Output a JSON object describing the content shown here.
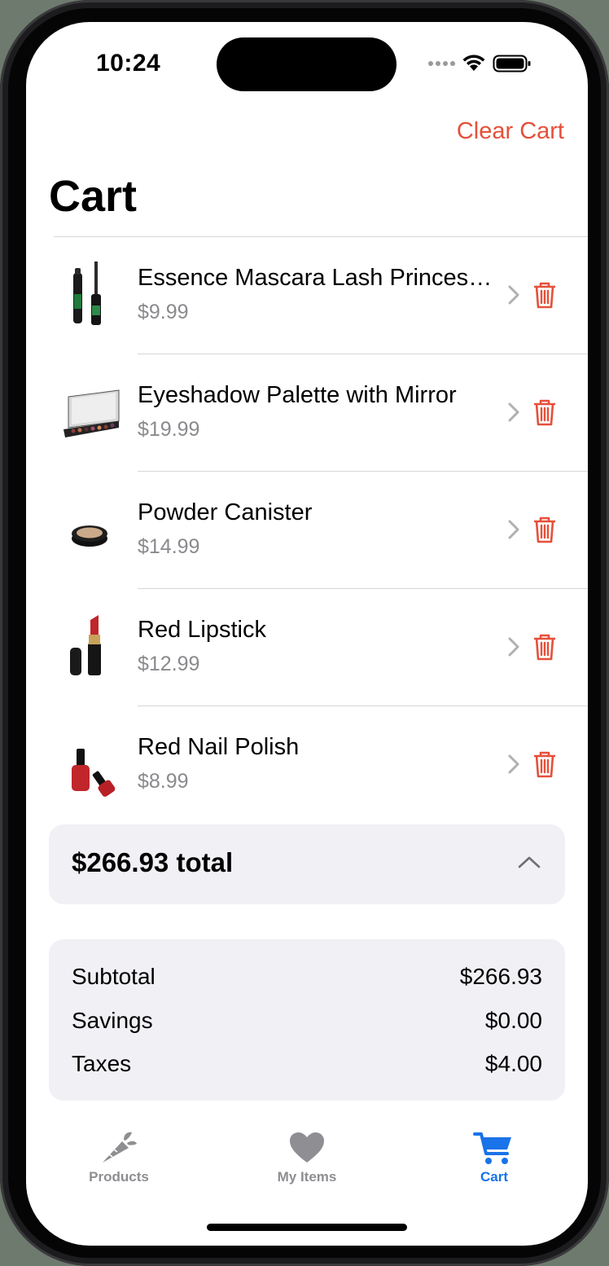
{
  "status_bar": {
    "time": "10:24"
  },
  "header": {
    "clear_cart_label": "Clear Cart",
    "title": "Cart"
  },
  "cart_items": [
    {
      "name": "Essence Mascara Lash Princess False Lash Effect Mascara",
      "price": "$9.99"
    },
    {
      "name": "Eyeshadow Palette with Mirror",
      "price": "$19.99"
    },
    {
      "name": "Powder Canister",
      "price": "$14.99"
    },
    {
      "name": "Red Lipstick",
      "price": "$12.99"
    },
    {
      "name": "Red Nail Polish",
      "price": "$8.99"
    }
  ],
  "total": {
    "label": "$266.93 total"
  },
  "summary": {
    "rows": [
      {
        "label": "Subtotal",
        "value": "$266.93"
      },
      {
        "label": "Savings",
        "value": "$0.00"
      },
      {
        "label": "Taxes",
        "value": "$4.00"
      }
    ]
  },
  "tabs": [
    {
      "label": "Products",
      "icon": "carrot-icon",
      "active": false
    },
    {
      "label": "My Items",
      "icon": "heart-icon",
      "active": false
    },
    {
      "label": "Cart",
      "icon": "cart-icon",
      "active": true
    }
  ],
  "colors": {
    "accent_red": "#e5503a",
    "tab_active": "#1a73e8",
    "tab_inactive": "#8e8e93",
    "card_bg": "#f0f0f5"
  }
}
